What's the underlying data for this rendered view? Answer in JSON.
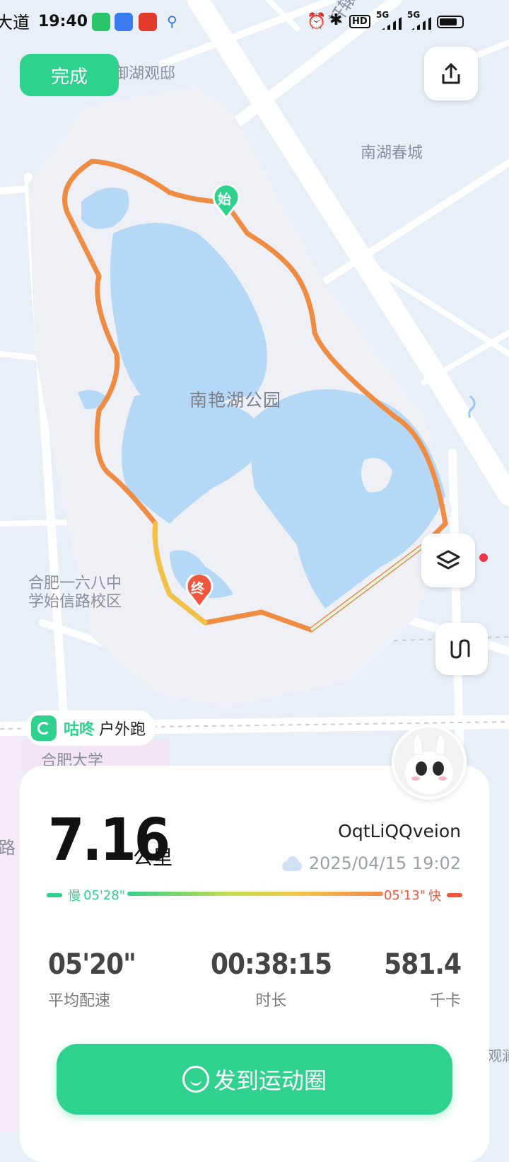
{
  "status_bar": {
    "road_fragment": "大道",
    "time": "19:40",
    "network_1": "5G",
    "network_2": "5G",
    "hd_badge": "HD"
  },
  "top": {
    "done_label": "完成"
  },
  "map": {
    "labels": {
      "road_xuanyuan": "轩辕路",
      "yuhu_guandi": "御湖观邸",
      "nanhu_chuncheng": "南湖春城",
      "park": "南艳湖公园",
      "school_line1": "合肥一六八中",
      "school_line2": "学始信路校区",
      "hefei_univ": "合肥大学",
      "road_fragment_left": "路",
      "right_fragment": "观澜"
    },
    "start_marker": "始",
    "end_marker": "终"
  },
  "brand": {
    "name": "咕咚",
    "activity": "户外跑"
  },
  "summary": {
    "distance": "7.16",
    "distance_unit": "公里",
    "username": "OqtLiQQveion",
    "datetime": "2025/04/15 19:02",
    "pace_slow_label": "慢",
    "pace_slow": "05'28\"",
    "pace_fast": "05'13\"",
    "pace_fast_label": "快"
  },
  "stats": [
    {
      "value": "05'20\"",
      "label": "平均配速"
    },
    {
      "value": "00:38:15",
      "label": "时长"
    },
    {
      "value": "581.4",
      "label": "千卡"
    }
  ],
  "share": {
    "label": "发到运动圈"
  },
  "colors": {
    "accent": "#2ed18e",
    "route": "#ef8c44",
    "fast": "#f0573f"
  }
}
